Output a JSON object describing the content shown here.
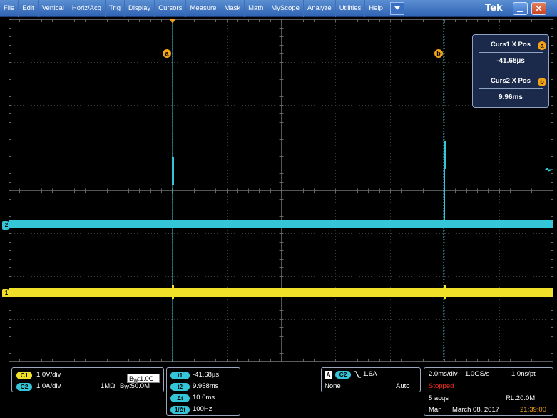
{
  "menu": {
    "items": [
      "File",
      "Edit",
      "Vertical",
      "Horiz/Acq",
      "Trig",
      "Display",
      "Cursors",
      "Measure",
      "Mask",
      "Math",
      "MyScope",
      "Analyze",
      "Utilities",
      "Help"
    ],
    "brand": "Tek",
    "close_symbol": "✕"
  },
  "cursors": {
    "curs1_label": "Curs1 X Pos",
    "curs1_badge": "a",
    "curs1_value": "-41.68µs",
    "curs2_label": "Curs2 X Pos",
    "curs2_badge": "b",
    "curs2_value": "9.96ms"
  },
  "markers": {
    "ch1": "1",
    "ch2": "2"
  },
  "channels": {
    "c1_chip": "C1",
    "c1_scale": "1.0V/div",
    "c2_chip": "C2",
    "c2_scale": "1.0A/div",
    "bw1_prefix": "B",
    "bw1_sub": "W",
    "bw1_value": ":1.0G",
    "impedance": "1MΩ",
    "bw2_prefix": "B",
    "bw2_sub": "W",
    "bw2_value": ":50.0M"
  },
  "cursor_table": [
    {
      "label": "t1",
      "value": "-41.68µs"
    },
    {
      "label": "t2",
      "value": "9.958ms"
    },
    {
      "label": "Δt",
      "value": "10.0ms"
    },
    {
      "label": "1/Δt",
      "value": "100Hz"
    }
  ],
  "trigger": {
    "mode_letter": "A",
    "source": "C2",
    "level": "1.6A",
    "coupling": "None",
    "mode": "Auto"
  },
  "acquisition": {
    "time_div": "2.0ms/div",
    "sample_rate": "1.0GS/s",
    "resolution": "1.0ns/pt",
    "state": "Stopped",
    "acqs": "5 acqs",
    "record_length": "RL:20.0M",
    "mode": "Man",
    "date": "March 08, 2017",
    "time": "21:39:00"
  },
  "colors": {
    "ch1": "#f0e02a",
    "ch2": "#34c6d8",
    "cursor_badge": "#f2a31a",
    "stopped": "#ff2a1a",
    "time_orange": "#f2a31a"
  }
}
